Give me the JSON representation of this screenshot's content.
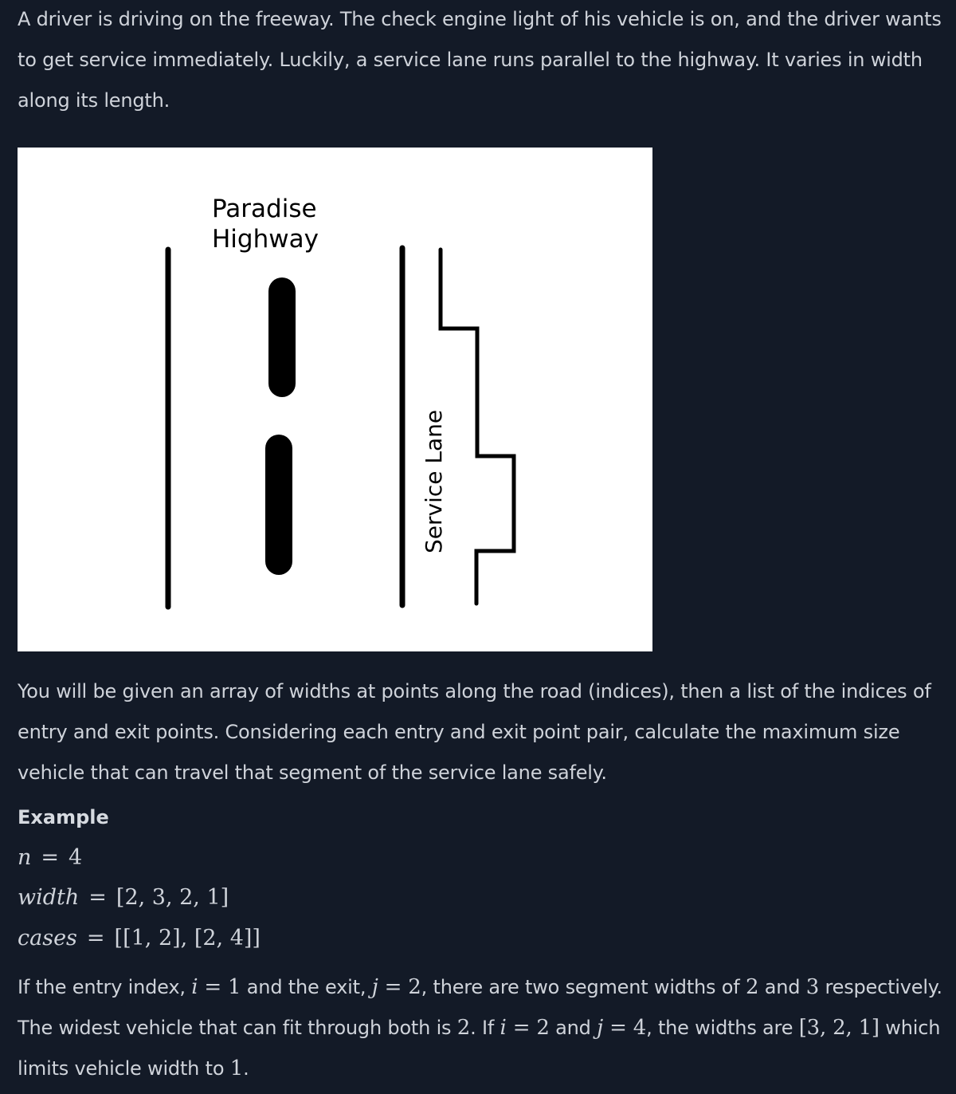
{
  "intro": "A driver is driving on the freeway. The check engine light of his vehicle is on, and the driver wants to get service immediately. Luckily, a service lane runs parallel to the highway. It varies in width along its length.",
  "figure": {
    "highway_label_line1": "Paradise",
    "highway_label_line2": "Highway",
    "lane_label": "Service Lane"
  },
  "description": "You will be given an array of widths at points along the road (indices), then a list of the indices of entry and exit points. Considering each entry and exit point pair, calculate the maximum size vehicle that can travel that segment of the service lane safely.",
  "example": {
    "heading": "Example",
    "n_var": "n",
    "n_value": "4",
    "width_var": "width",
    "width_value": "[2, 3, 2, 1]",
    "cases_var": "cases",
    "cases_value": "[[1, 2], [2, 4]]",
    "eq": "="
  },
  "explanation": {
    "t1": "If the entry index, ",
    "i": "i",
    "eq1": " = 1",
    "t2": " and the exit, ",
    "j": "j",
    "eq2": " = 2",
    "t3": ", there are two segment widths of ",
    "v1": "2",
    "t4": " and ",
    "v2": "3",
    "t5": " respectively. The widest vehicle that can fit through both is ",
    "v3": "2",
    "t6": ". If ",
    "i2": "i",
    "eq3": " = 2",
    "t7": " and ",
    "j2": "j",
    "eq4": " = 4",
    "t8": ", the widths are ",
    "arr": "[3, 2, 1]",
    "t9": " which limits vehicle width to ",
    "v4": "1",
    "t10": "."
  }
}
